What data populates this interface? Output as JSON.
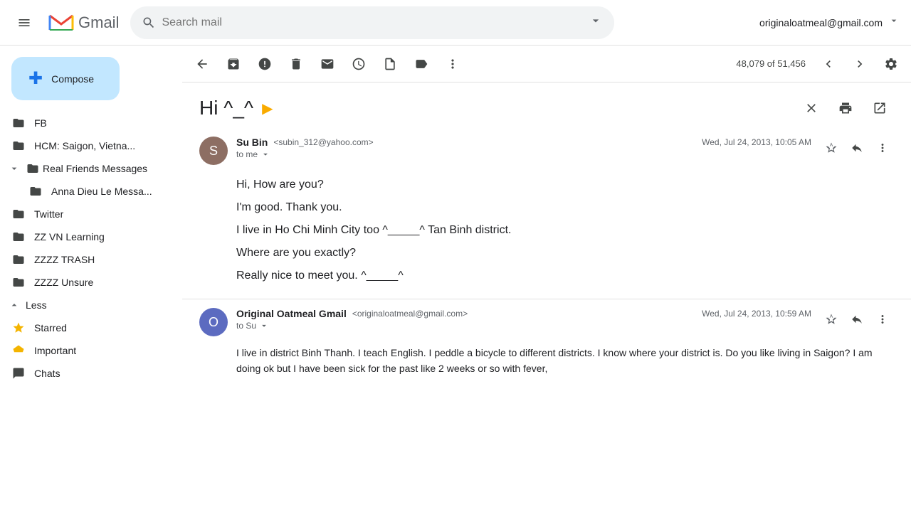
{
  "topbar": {
    "search_placeholder": "Search mail",
    "user_email": "originaloatmeal@gmail.com"
  },
  "sidebar": {
    "compose_label": "Compose",
    "items": [
      {
        "id": "fb",
        "label": "FB",
        "icon": "folder"
      },
      {
        "id": "hcm",
        "label": "HCM: Saigon, Vietna...",
        "icon": "folder"
      },
      {
        "id": "real-friends",
        "label": "Real Friends Messages",
        "icon": "folder",
        "expanded": true
      },
      {
        "id": "anna",
        "label": "Anna Dieu Le Messa...",
        "icon": "folder",
        "sub": true
      },
      {
        "id": "twitter",
        "label": "Twitter",
        "icon": "folder"
      },
      {
        "id": "zz-vn",
        "label": "ZZ VN Learning",
        "icon": "folder"
      },
      {
        "id": "zzzz-trash",
        "label": "ZZZZ TRASH",
        "icon": "folder"
      },
      {
        "id": "zzzz-unsure",
        "label": "ZZZZ Unsure",
        "icon": "folder"
      }
    ],
    "less_label": "Less",
    "starred_label": "Starred",
    "important_label": "Important",
    "chats_label": "Chats"
  },
  "toolbar": {
    "count_text": "48,079 of 51,456"
  },
  "email": {
    "subject": "Hi ^_^",
    "messages": [
      {
        "sender_name": "Su Bin",
        "sender_email": "<subin_312@yahoo.com>",
        "date": "Wed, Jul 24, 2013, 10:05 AM",
        "to": "to me",
        "body_lines": [
          "Hi, How are you?",
          "I'm good. Thank you.",
          "I live in Ho Chi Minh City too ^_____^ Tan Binh district.",
          "Where are you exactly?",
          "Really nice to meet you. ^_____^"
        ]
      },
      {
        "sender_name": "Original Oatmeal Gmail",
        "sender_email": "<originaloatmeal@gmail.com>",
        "date": "Wed, Jul 24, 2013, 10:59 AM",
        "to": "to Su",
        "body_text": "I live in district Binh Thanh. I teach English. I peddle a bicycle to different districts. I know where your district is. Do you like living in Saigon? I am doing ok but I have been sick for the past like 2 weeks or so with fever,"
      }
    ]
  }
}
